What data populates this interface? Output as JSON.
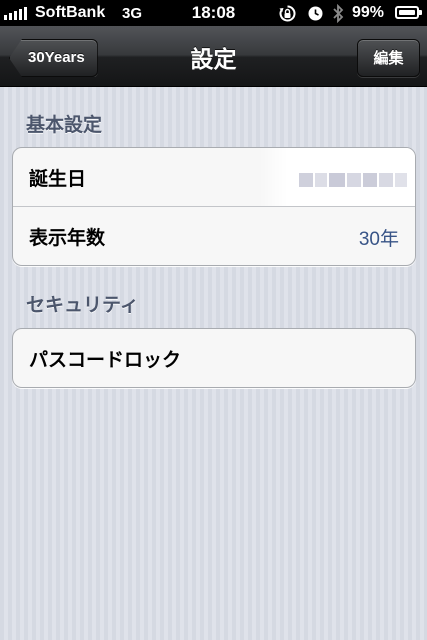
{
  "status_bar": {
    "carrier": "SoftBank",
    "network": "3G",
    "time": "18:08",
    "battery": "99%",
    "icons": [
      "signal-icon",
      "rotation-lock-icon",
      "alarm-icon",
      "bluetooth-icon",
      "battery-icon"
    ]
  },
  "nav": {
    "back_label": "30Years",
    "title": "設定",
    "edit_label": "編集"
  },
  "sections": [
    {
      "header": "基本設定",
      "rows": [
        {
          "label": "誕生日",
          "value": ""
        },
        {
          "label": "表示年数",
          "value": "30年"
        }
      ]
    },
    {
      "header": "セキュリティ",
      "rows": [
        {
          "label": "パスコードロック",
          "value": ""
        }
      ]
    }
  ],
  "colors": {
    "background": "#d9dde6",
    "value_text": "#385487",
    "section_header": "#4c566c",
    "nav_bar": "#2a2b2e"
  }
}
